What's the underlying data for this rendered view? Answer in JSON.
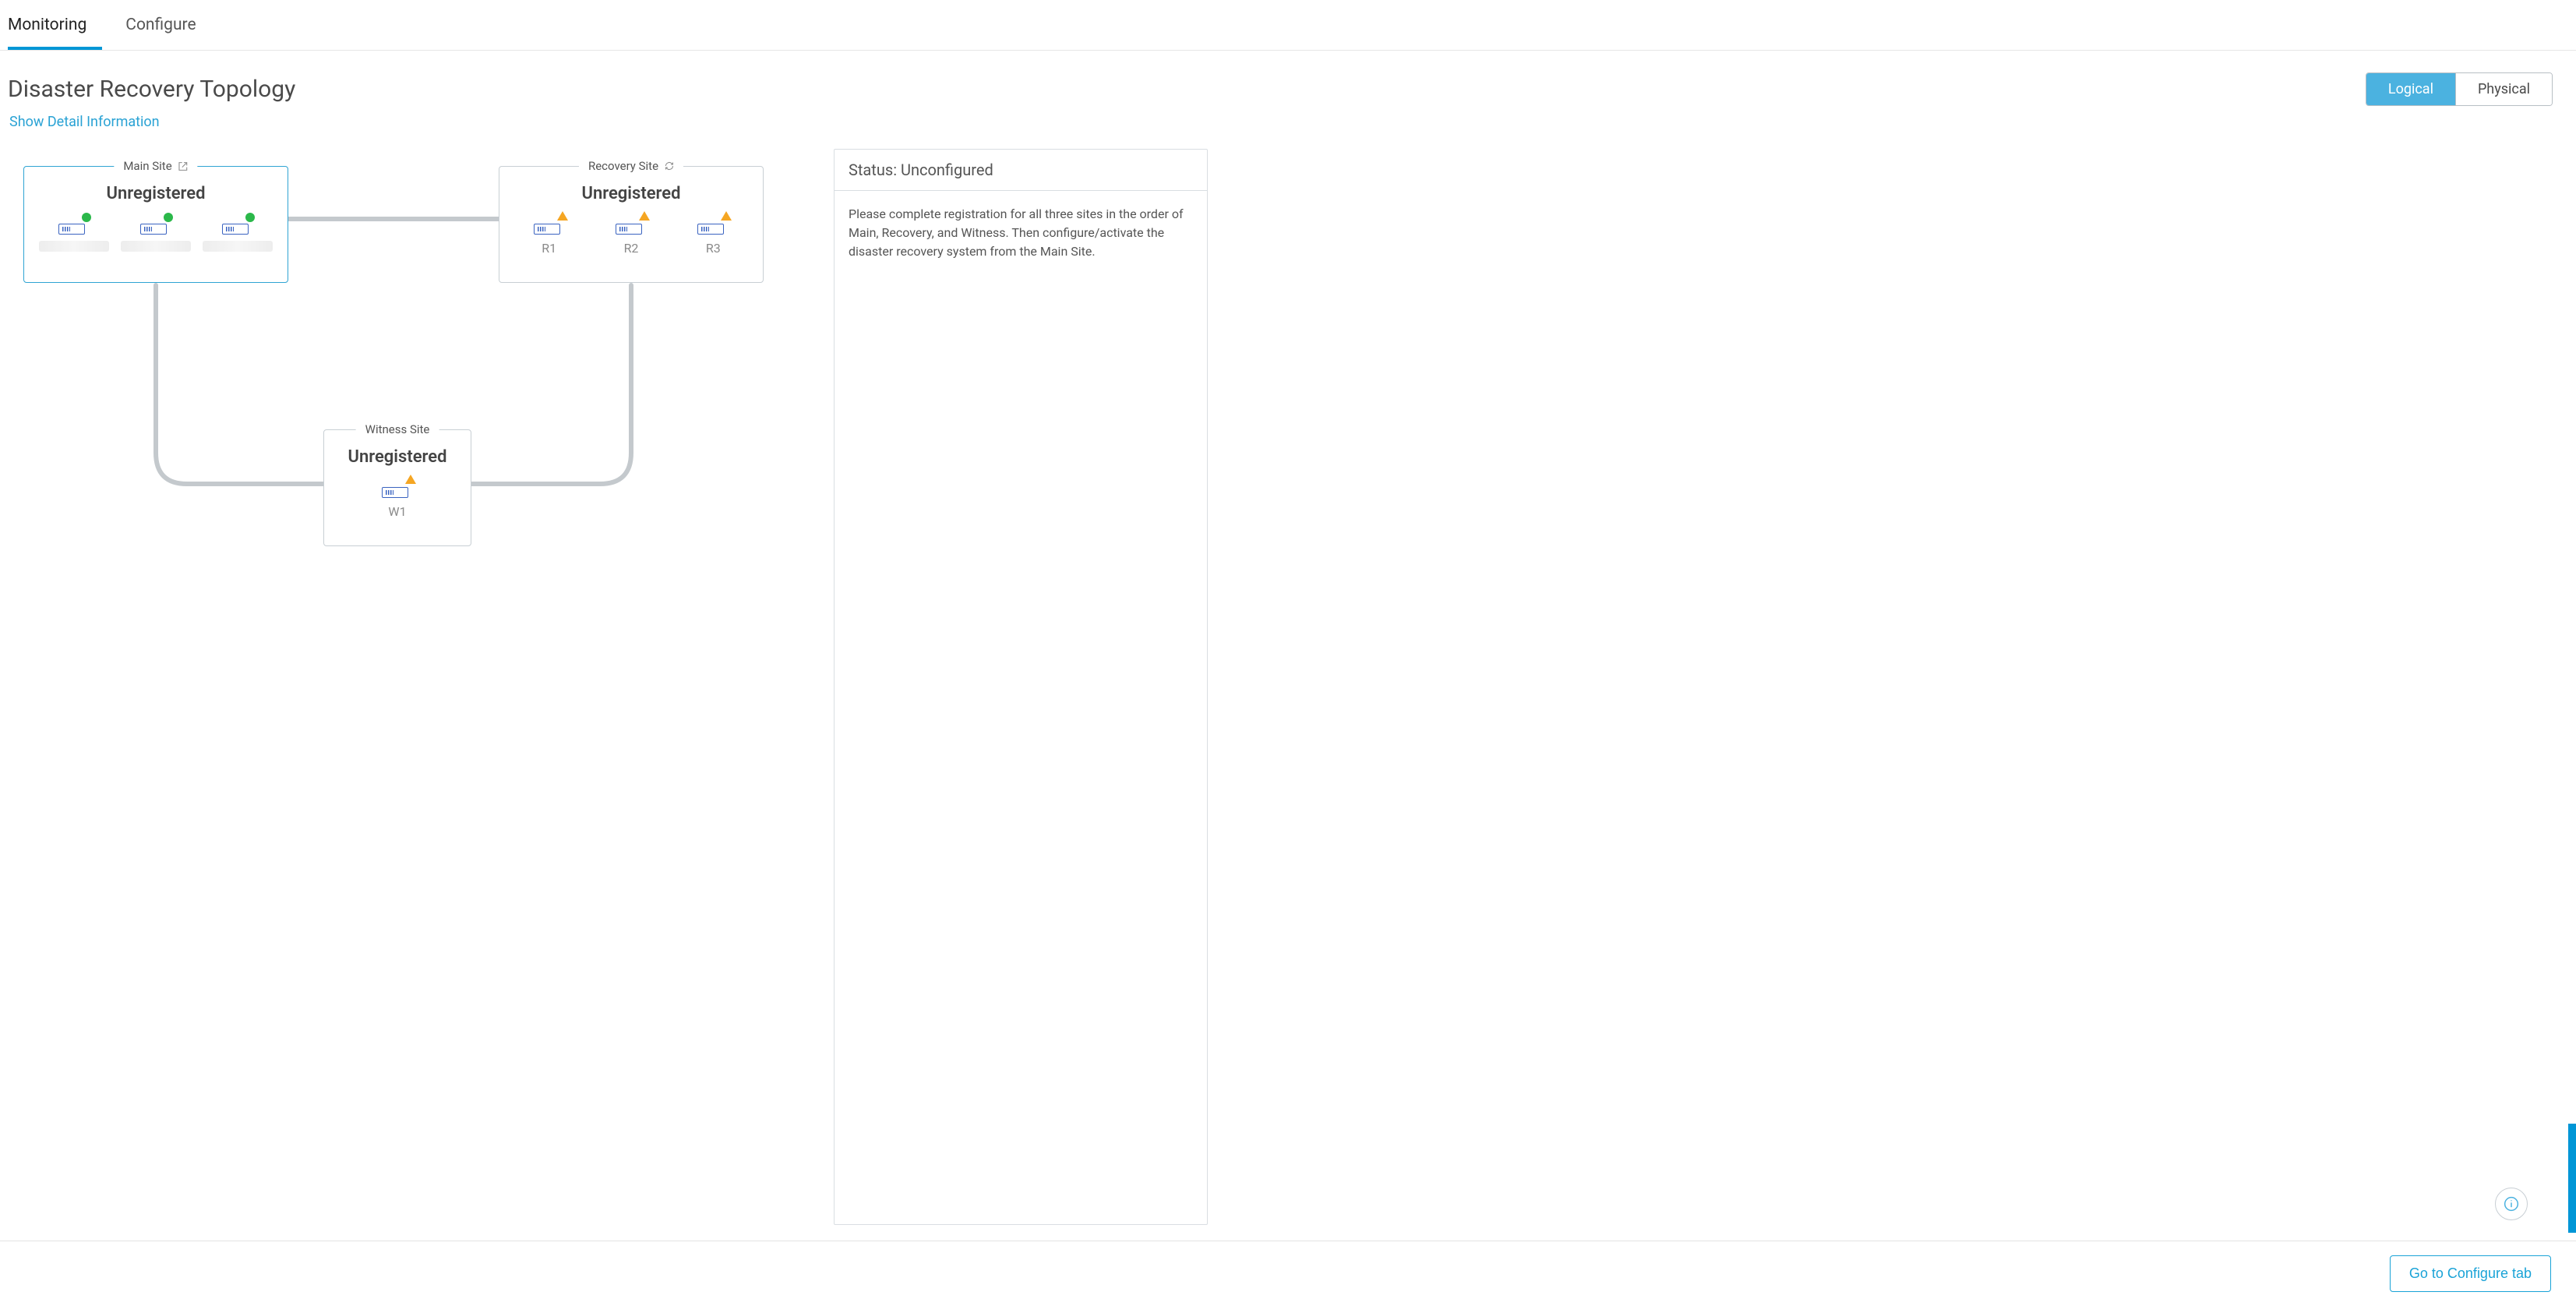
{
  "tabs": {
    "monitoring": "Monitoring",
    "configure": "Configure",
    "active": "monitoring"
  },
  "page": {
    "title": "Disaster Recovery Topology",
    "detail_link": "Show Detail Information"
  },
  "view_toggle": {
    "logical": "Logical",
    "physical": "Physical",
    "active": "logical"
  },
  "sites": {
    "main": {
      "title": "Main Site",
      "status": "Unregistered",
      "nodes": [
        {
          "id": "m1",
          "label_hidden": true,
          "indicator": "green"
        },
        {
          "id": "m2",
          "label_hidden": true,
          "indicator": "green"
        },
        {
          "id": "m3",
          "label_hidden": true,
          "indicator": "green"
        }
      ]
    },
    "recovery": {
      "title": "Recovery Site",
      "status": "Unregistered",
      "nodes": [
        {
          "id": "r1",
          "label": "R1",
          "indicator": "warning"
        },
        {
          "id": "r2",
          "label": "R2",
          "indicator": "warning"
        },
        {
          "id": "r3",
          "label": "R3",
          "indicator": "warning"
        }
      ]
    },
    "witness": {
      "title": "Witness Site",
      "status": "Unregistered",
      "nodes": [
        {
          "id": "w1",
          "label": "W1",
          "indicator": "warning"
        }
      ]
    }
  },
  "status_panel": {
    "prefix": "Status: ",
    "value": "Unconfigured",
    "message": "Please complete registration for all three sites in the order of Main, Recovery, and Witness. Then configure/activate the disaster recovery system from the Main Site."
  },
  "bottom": {
    "configure_button": "Go to Configure tab"
  }
}
